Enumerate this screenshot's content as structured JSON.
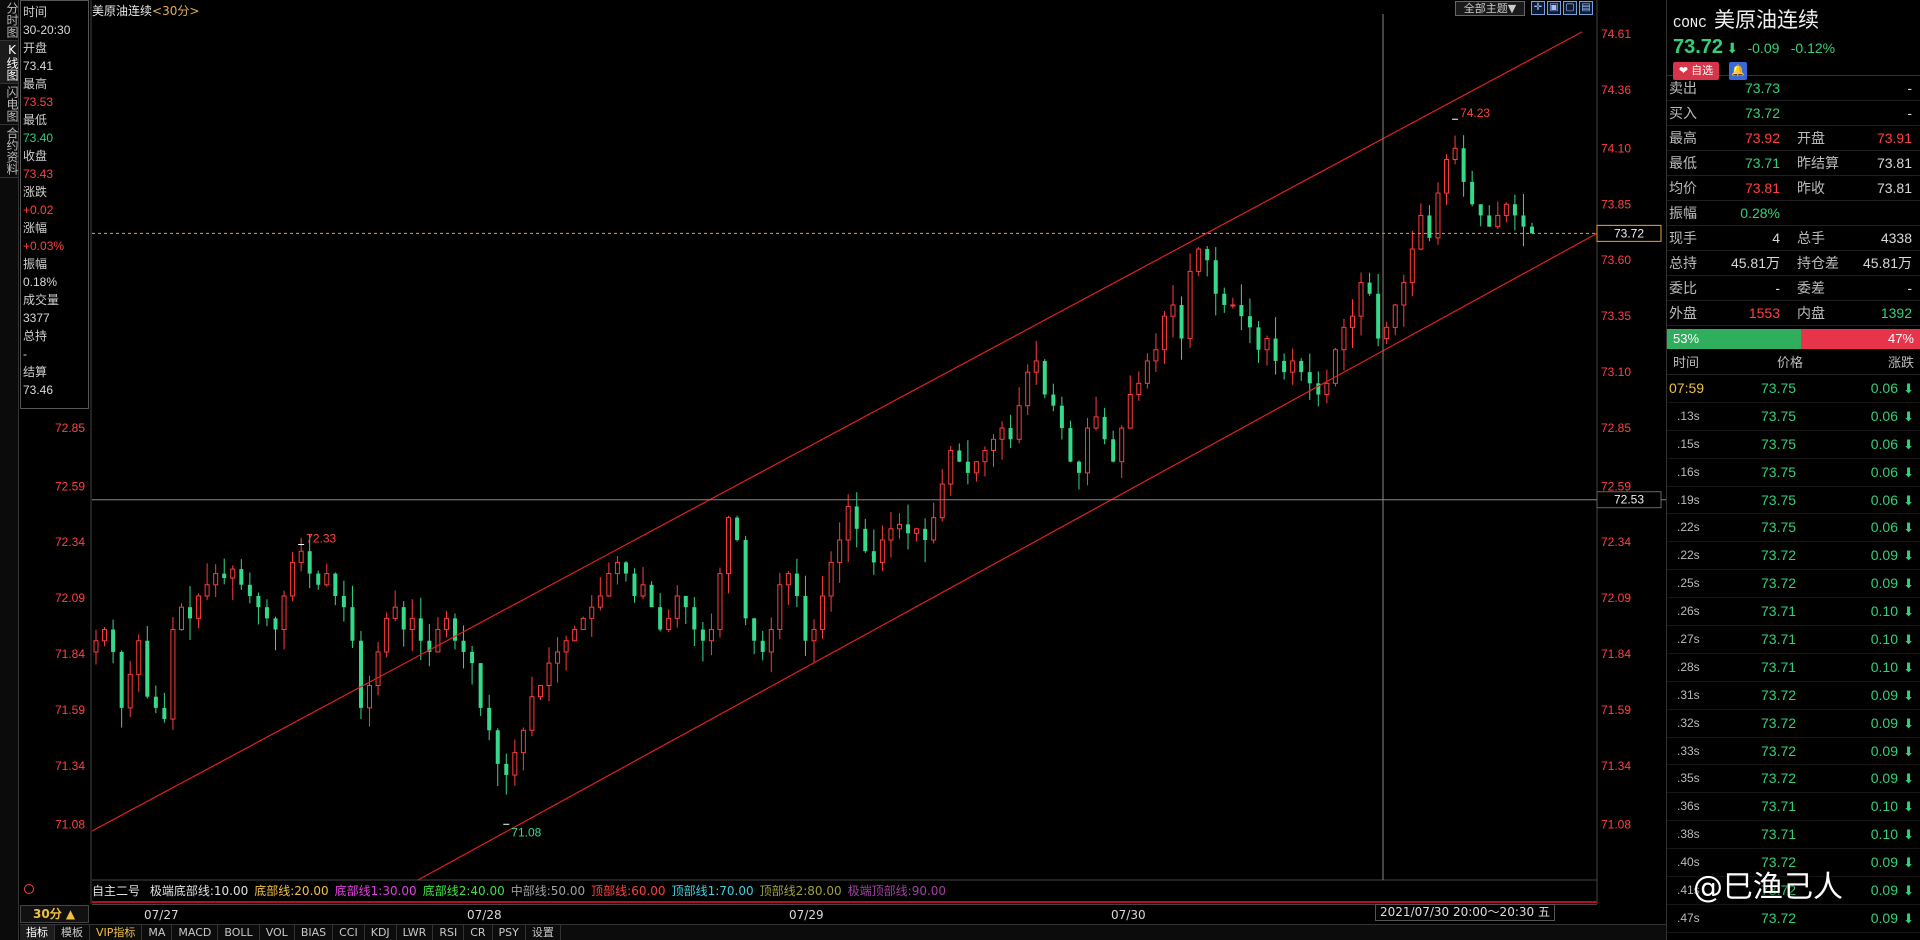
{
  "left_tabs": [
    "分时图",
    "K线图",
    "闪电图",
    "合约资料"
  ],
  "info_panel": [
    {
      "label": "时间",
      "value": "30-20:30",
      "color": "white"
    },
    {
      "label": "开盘",
      "value": "73.41",
      "color": "white"
    },
    {
      "label": "最高",
      "value": "73.53",
      "color": "red"
    },
    {
      "label": "最低",
      "value": "73.40",
      "color": "green"
    },
    {
      "label": "收盘",
      "value": "73.43",
      "color": "red"
    },
    {
      "label": "涨跌",
      "value": "+0.02",
      "color": "red"
    },
    {
      "label": "涨幅",
      "value": "+0.03%",
      "color": "red"
    },
    {
      "label": "振幅",
      "value": "0.18%",
      "color": "white"
    },
    {
      "label": "成交量",
      "value": "3377",
      "color": "white"
    },
    {
      "label": "总持",
      "value": "-",
      "color": "white"
    },
    {
      "label": "结算",
      "value": "73.46",
      "color": "white"
    }
  ],
  "chart_header": {
    "title": "美原油连续",
    "period": "<30分>",
    "theme_button": "全部主题▼"
  },
  "indicator": {
    "name": "自主二号",
    "params": [
      {
        "text": "极端底部线:10.00",
        "color": "#e0e0e0"
      },
      {
        "text": "底部线:20.00",
        "color": "#f0c040"
      },
      {
        "text": "底部线1:30.00",
        "color": "#e040e0"
      },
      {
        "text": "底部线2:40.00",
        "color": "#40e040"
      },
      {
        "text": "中部线:50.00",
        "color": "#a0a0a0"
      },
      {
        "text": "顶部线:60.00",
        "color": "#ff4040"
      },
      {
        "text": "顶部线1:70.00",
        "color": "#40d0e0"
      },
      {
        "text": "顶部线2:80.00",
        "color": "#a0a040"
      },
      {
        "text": "极端顶部线:90.00",
        "color": "#a040a0"
      }
    ]
  },
  "period_box": "30分 ▲",
  "date_axis": [
    "07/27",
    "07/28",
    "07/29",
    "07/30"
  ],
  "crosshair_date": "2021/07/30 20:00～20:30 五",
  "bottom_tabs": [
    "指标",
    "模板",
    "VIP指标",
    "MA",
    "MACD",
    "BOLL",
    "VOL",
    "BIAS",
    "CCI",
    "KDJ",
    "LWR",
    "RSI",
    "CR",
    "PSY",
    "设置"
  ],
  "chart_data": {
    "type": "candlestick",
    "y_ticks_right": [
      "74.61",
      "74.36",
      "74.10",
      "73.85",
      "73.60",
      "73.35",
      "73.10",
      "72.85",
      "72.59",
      "72.34",
      "72.09",
      "71.84",
      "71.59",
      "71.34",
      "71.08"
    ],
    "y_ticks_left": [
      "72.85",
      "72.59",
      "72.34",
      "72.09",
      "71.84",
      "71.59",
      "71.34",
      "71.08"
    ],
    "ylim": [
      70.84,
      74.7
    ],
    "annotations": {
      "high_label": "74.23",
      "high_value": 74.23,
      "low_label": "71.08",
      "low_value": 71.08,
      "local_high_label": "72.33",
      "local_high_value": 72.33
    },
    "current_price": "73.72",
    "crosshair_price": "72.53",
    "closes": [
      71.9,
      71.95,
      71.85,
      71.6,
      71.75,
      71.9,
      71.65,
      71.6,
      71.55,
      71.95,
      72.05,
      72.0,
      72.1,
      72.15,
      72.2,
      72.18,
      72.22,
      72.15,
      72.1,
      72.05,
      72.0,
      71.95,
      72.1,
      72.25,
      72.3,
      72.2,
      72.15,
      72.2,
      72.1,
      72.05,
      71.9,
      71.6,
      71.7,
      71.85,
      72.0,
      72.05,
      71.95,
      72.0,
      71.9,
      71.85,
      71.95,
      72.0,
      71.9,
      71.85,
      71.8,
      71.6,
      71.5,
      71.35,
      71.3,
      71.4,
      71.5,
      71.65,
      71.7,
      71.8,
      71.85,
      71.9,
      71.95,
      72.0,
      72.05,
      72.1,
      72.2,
      72.25,
      72.2,
      72.1,
      72.15,
      72.05,
      71.95,
      72.0,
      72.1,
      72.05,
      71.95,
      71.9,
      71.95,
      72.2,
      72.45,
      72.35,
      72.0,
      71.9,
      71.85,
      71.95,
      72.15,
      72.2,
      72.1,
      71.9,
      71.95,
      72.1,
      72.25,
      72.35,
      72.5,
      72.4,
      72.3,
      72.25,
      72.35,
      72.4,
      72.42,
      72.38,
      72.4,
      72.35,
      72.45,
      72.6,
      72.75,
      72.7,
      72.65,
      72.7,
      72.75,
      72.8,
      72.85,
      72.8,
      72.95,
      73.1,
      73.15,
      73.0,
      72.95,
      72.85,
      72.7,
      72.65,
      72.85,
      72.9,
      72.8,
      72.7,
      72.85,
      73.0,
      73.05,
      73.15,
      73.2,
      73.35,
      73.4,
      73.25,
      73.55,
      73.65,
      73.6,
      73.45,
      73.4,
      73.4,
      73.35,
      73.3,
      73.2,
      73.25,
      73.15,
      73.1,
      73.15,
      73.1,
      73.05,
      73.0,
      73.05,
      73.2,
      73.3,
      73.35,
      73.5,
      73.45,
      73.25,
      73.3,
      73.4,
      73.5,
      73.65,
      73.8,
      73.7,
      73.9,
      74.05,
      74.1,
      73.95,
      73.85,
      73.8,
      73.75,
      73.8,
      73.85,
      73.8,
      73.75,
      73.72
    ]
  },
  "quote": {
    "code": "CONC",
    "name": "美原油连续",
    "price": "73.72",
    "arrow": "⬇",
    "change": "-0.09",
    "change_pct": "-0.12%",
    "fav_label": "❤ 自选",
    "bell_icon": "🔔",
    "rows": [
      {
        "l1": "卖出",
        "v1": "73.73",
        "c1": "green",
        "l2": "",
        "v2": "-",
        "c2": "white"
      },
      {
        "l1": "买入",
        "v1": "73.72",
        "c1": "green",
        "l2": "",
        "v2": "-",
        "c2": "white"
      },
      {
        "l1": "最高",
        "v1": "73.92",
        "c1": "red",
        "l2": "开盘",
        "v2": "73.91",
        "c2": "red"
      },
      {
        "l1": "最低",
        "v1": "73.71",
        "c1": "green",
        "l2": "昨结算",
        "v2": "73.81",
        "c2": "white"
      },
      {
        "l1": "均价",
        "v1": "73.81",
        "c1": "red",
        "l2": "昨收",
        "v2": "73.81",
        "c2": "white"
      },
      {
        "l1": "振幅",
        "v1": "0.28%",
        "c1": "green",
        "l2": "",
        "v2": "",
        "c2": "white"
      },
      {
        "l1": "现手",
        "v1": "4",
        "c1": "white",
        "l2": "总手",
        "v2": "4338",
        "c2": "white"
      },
      {
        "l1": "总持",
        "v1": "45.81万",
        "c1": "white",
        "l2": "持仓差",
        "v2": "45.81万",
        "c2": "white"
      },
      {
        "l1": "委比",
        "v1": "-",
        "c1": "white",
        "l2": "委差",
        "v2": "-",
        "c2": "white"
      },
      {
        "l1": "外盘",
        "v1": "1553",
        "c1": "red",
        "l2": "内盘",
        "v2": "1392",
        "c2": "green"
      }
    ],
    "buy_ratio_label": "53%",
    "buy_ratio": 0.53,
    "sell_ratio_label": "47%",
    "ticks_header": {
      "time": "时间",
      "price": "价格",
      "change": "涨跌"
    },
    "ticks": [
      {
        "t": "07:59",
        "p": "73.75",
        "c": "0.06"
      },
      {
        "t": ".13s",
        "p": "73.75",
        "c": "0.06"
      },
      {
        "t": ".15s",
        "p": "73.75",
        "c": "0.06"
      },
      {
        "t": ".16s",
        "p": "73.75",
        "c": "0.06"
      },
      {
        "t": ".19s",
        "p": "73.75",
        "c": "0.06"
      },
      {
        "t": ".22s",
        "p": "73.75",
        "c": "0.06"
      },
      {
        "t": ".22s",
        "p": "73.72",
        "c": "0.09"
      },
      {
        "t": ".25s",
        "p": "73.72",
        "c": "0.09"
      },
      {
        "t": ".26s",
        "p": "73.71",
        "c": "0.10"
      },
      {
        "t": ".27s",
        "p": "73.71",
        "c": "0.10"
      },
      {
        "t": ".28s",
        "p": "73.71",
        "c": "0.10"
      },
      {
        "t": ".31s",
        "p": "73.72",
        "c": "0.09"
      },
      {
        "t": ".32s",
        "p": "73.72",
        "c": "0.09"
      },
      {
        "t": ".33s",
        "p": "73.72",
        "c": "0.09"
      },
      {
        "t": ".35s",
        "p": "73.72",
        "c": "0.09"
      },
      {
        "t": ".36s",
        "p": "73.71",
        "c": "0.10"
      },
      {
        "t": ".38s",
        "p": "73.71",
        "c": "0.10"
      },
      {
        "t": ".40s",
        "p": "73.72",
        "c": "0.09"
      },
      {
        "t": ".41s",
        "p": "73.72",
        "c": "0.09"
      },
      {
        "t": ".47s",
        "p": "73.72",
        "c": "0.09"
      }
    ]
  },
  "watermark": "@巳渔己人"
}
